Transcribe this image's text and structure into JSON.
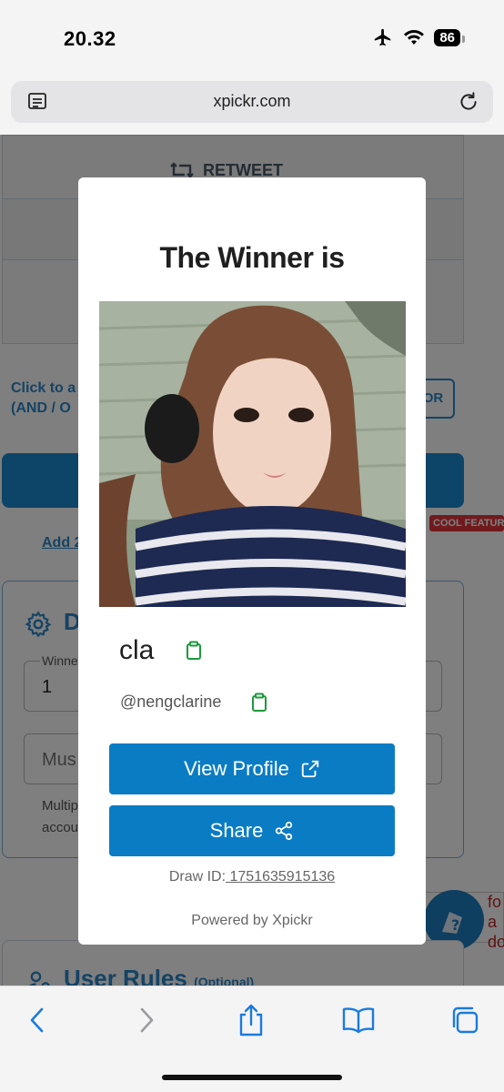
{
  "status": {
    "time": "20.32",
    "battery": "86"
  },
  "browser": {
    "url": "xpickr.com"
  },
  "background": {
    "retweet_label": "RETWEET",
    "click_text_line1": "Click to a",
    "click_text_line2": "(AND / O",
    "or_button": "OR",
    "cool_badge": "COOL FEATUR",
    "add_link": "Add 2",
    "section_title": "D",
    "winners_label": "Winne",
    "winners_value": "1",
    "must_placeholder": "Mus",
    "multi_line1": "Multip",
    "multi_line2": "accou",
    "help_line1": "fo",
    "help_line2": "a do",
    "user_rules_title": "User Rules",
    "user_rules_optional": "(Optional)"
  },
  "modal": {
    "title": "The Winner is",
    "winner_name": "cla",
    "winner_handle": "@nengclarine",
    "view_profile_label": "View Profile",
    "share_label": "Share",
    "draw_id_label": "Draw ID:",
    "draw_id_value": " 1751635915136",
    "powered_by": "Powered by Xpickr"
  },
  "colors": {
    "primary": "#0a7cc4",
    "copy_icon": "#1a9a3a",
    "badge": "#e0353a"
  },
  "icons": [
    "airplane-icon",
    "wifi-icon",
    "reader-icon",
    "reload-icon",
    "copy-icon",
    "external-link-icon",
    "share-icon",
    "back-icon",
    "forward-icon",
    "share-sheet-icon",
    "bookmarks-icon",
    "tabs-icon"
  ]
}
